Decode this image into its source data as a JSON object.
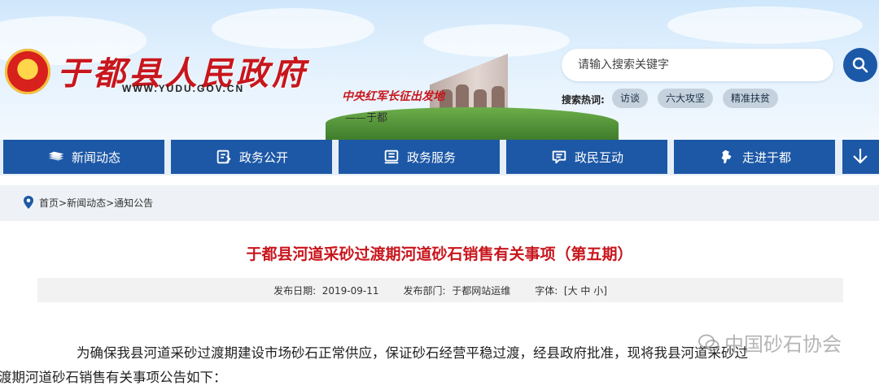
{
  "header": {
    "site_title": "于都县人民政府",
    "site_url": "WWW.YUDU.GOV.CN",
    "slogan": "中央红军长征出发地",
    "slogan_sub": "——于都"
  },
  "search": {
    "placeholder": "请输入搜索关键字",
    "hot_label": "搜索热词:",
    "hot_tags": [
      "访谈",
      "六大攻坚",
      "精准扶贫"
    ]
  },
  "nav": {
    "items": [
      {
        "label": "新闻动态",
        "icon": "newspaper-icon"
      },
      {
        "label": "政务公开",
        "icon": "document-icon"
      },
      {
        "label": "政务服务",
        "icon": "service-icon"
      },
      {
        "label": "政民互动",
        "icon": "chat-icon"
      },
      {
        "label": "走进于都",
        "icon": "map-icon"
      }
    ],
    "more_icon": "chevron-down-icon"
  },
  "breadcrumb": {
    "icon": "location-pin-icon",
    "items": [
      "首页",
      "新闻动态",
      "通知公告"
    ],
    "separator": ">"
  },
  "article": {
    "title": "于都县河道采砂过渡期河道砂石销售有关事项（第五期）",
    "date_label": "发布日期:",
    "date": "2019-09-11",
    "dept_label": "发布部门:",
    "dept": "于都网站运维",
    "font_label": "字体:",
    "font_sizes": "[大 中 小]",
    "body_line1": "为确保我县河道采砂过渡期建设市场砂石正常供应，保证砂石经营平稳过渡，经县政府批准，现将我县河道采砂过",
    "body_line2": "渡期河道砂石销售有关事项公告如下："
  },
  "watermark": {
    "text": "中国砂石协会",
    "icon": "wechat-icon"
  },
  "colors": {
    "brand_blue": "#1d58a6",
    "title_red": "#c8161d",
    "tag_gray": "#c5d2de"
  }
}
